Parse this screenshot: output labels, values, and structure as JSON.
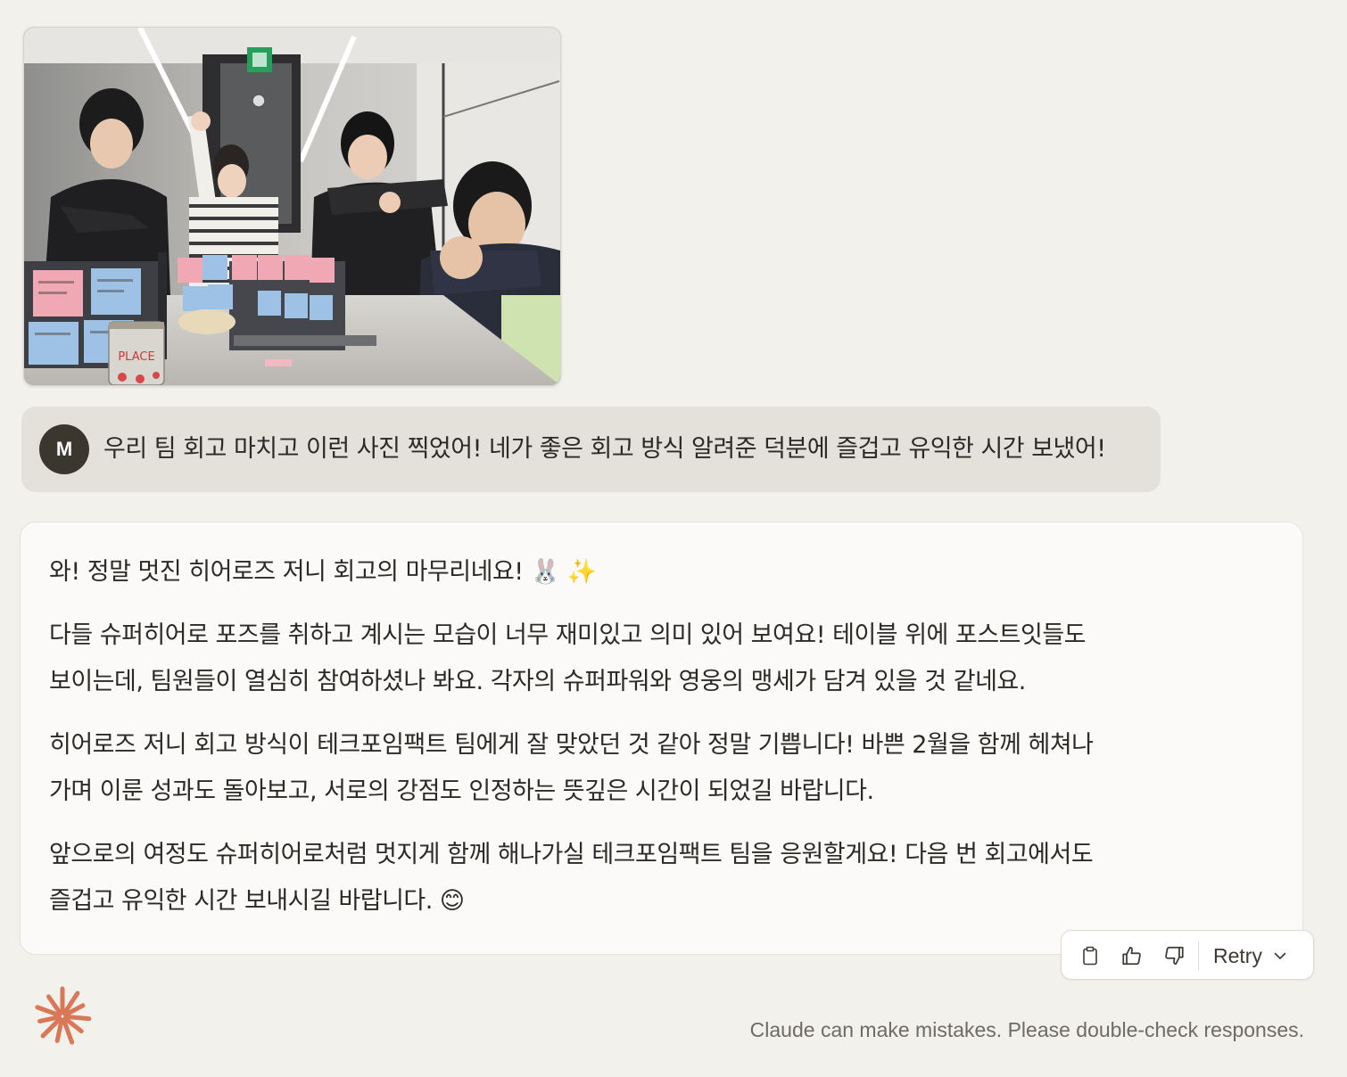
{
  "user_message": {
    "avatar_initial": "M",
    "text": "우리 팀 회고 마치고 이런 사진 찍었어! 네가 좋은 회고 방식 알려준 덕분에 즐겁고 유익한 시간 보냈어!",
    "attachment": {
      "type": "photo",
      "cup_label": "PLACE"
    }
  },
  "assistant_message": {
    "paragraphs": [
      {
        "lines": [
          "와! 정말 멋진 히어로즈 저니 회고의 마무리네요! 🐰 ✨"
        ]
      },
      {
        "lines": [
          "다들 슈퍼히어로 포즈를 취하고 계시는 모습이 너무 재미있고 의미 있어 보여요! 테이블 위에 포스트잇들도",
          "보이는데, 팀원들이 열심히 참여하셨나 봐요. 각자의 슈퍼파워와 영웅의 맹세가 담겨 있을 것 같네요."
        ]
      },
      {
        "lines": [
          "히어로즈 저니 회고 방식이 테크포임팩트 팀에게 잘 맞았던 것 같아 정말 기쁩니다! 바쁜 2월을 함께 헤쳐나",
          "가며 이룬 성과도 돌아보고, 서로의 강점도 인정하는 뜻깊은 시간이 되었길 바랍니다."
        ]
      },
      {
        "lines": [
          "앞으로의 여정도 슈퍼히어로처럼 멋지게 함께 해나가실 테크포임팩트 팀을 응원할게요! 다음 번 회고에서도",
          "즐겁고 유익한 시간 보내시길 바랍니다. 😊"
        ]
      }
    ]
  },
  "toolbar": {
    "copy_icon": "clipboard-icon",
    "thumbs_up_icon": "thumbs-up-icon",
    "thumbs_down_icon": "thumbs-down-icon",
    "retry_label": "Retry"
  },
  "footer": {
    "disclaimer": "Claude can make mistakes. Please double-check responses.",
    "logo_icon": "claude-starburst-icon"
  },
  "colors": {
    "background": "#f3f1ec",
    "user_bubble": "#e3e1da",
    "assistant_bubble": "#fbfaf8",
    "avatar": "#3b372e",
    "brand": "#d97757"
  }
}
